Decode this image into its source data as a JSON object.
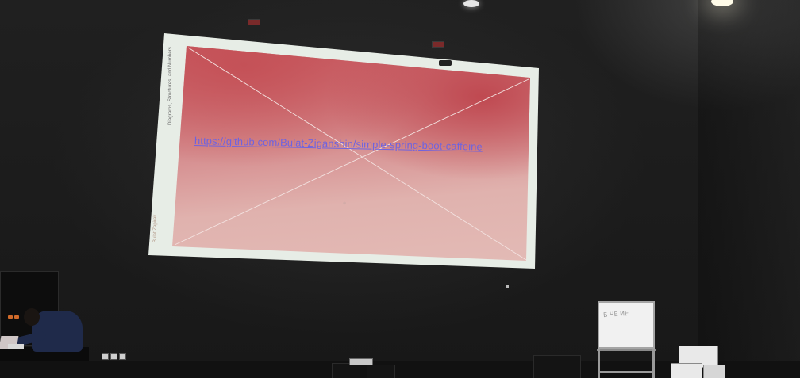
{
  "scene": {
    "description_colors": {
      "wall": "#1b1b1b",
      "screen_frame": "#e7ede6",
      "slide_red": "#c55058",
      "slide_pink": "#e3bbb6",
      "link_color": "#6e63e0"
    }
  },
  "slide": {
    "side_caption": "Diagrams, Structures, and Numbers",
    "author": "Bulat Zapirak",
    "link_text": "https://github.com/Bulat-Ziganshin/simple-spring-boot-caffeine",
    "center_mark": "⊕"
  },
  "whiteboard": {
    "scribble": "Б ЧЕ ИЕ"
  },
  "icons": {
    "ceiling_light": "ceiling-light-icon",
    "projector": "projector-mount-icon"
  }
}
